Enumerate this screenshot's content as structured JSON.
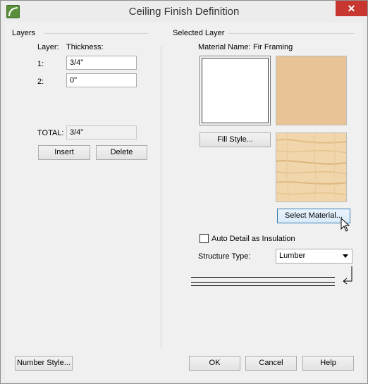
{
  "window": {
    "title": "Ceiling Finish Definition",
    "close_label": "✕"
  },
  "layers": {
    "group_title": "Layers",
    "header_layer": "Layer:",
    "header_thickness": "Thickness:",
    "rows": [
      {
        "index": "1:",
        "thickness": "3/4\""
      },
      {
        "index": "2:",
        "thickness": "0\""
      }
    ],
    "total_label": "TOTAL:",
    "total_value": "3/4\"",
    "insert_label": "Insert",
    "delete_label": "Delete"
  },
  "selected_layer": {
    "group_title": "Selected Layer",
    "material_name_label": "Material Name:",
    "material_name_value": "Fir Framing",
    "fill_style_label": "Fill Style...",
    "select_material_label": "Select Material...",
    "auto_detail_label": "Auto Detail as Insulation",
    "auto_detail_checked": false,
    "structure_type_label": "Structure Type:",
    "structure_type_value": "Lumber",
    "material_color": "#e8c396"
  },
  "footer": {
    "number_style_label": "Number Style...",
    "ok_label": "OK",
    "cancel_label": "Cancel",
    "help_label": "Help"
  }
}
